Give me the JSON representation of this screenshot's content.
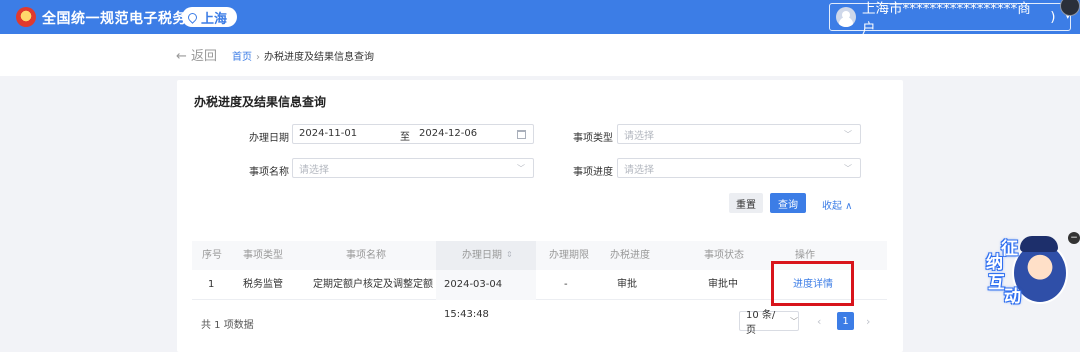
{
  "header": {
    "site_title": "全国统一规范电子税务局",
    "region": "上海",
    "user": "上海市*****************商户",
    "user_caret": ")",
    "menu_caret": "▾"
  },
  "breadcrumb": {
    "back": "← 返回",
    "home": "首页",
    "separator": "›",
    "current": "办税进度及结果信息查询"
  },
  "card": {
    "title": "办税进度及结果信息查询"
  },
  "filters": {
    "date_label": "办理日期",
    "date_start": "2024-11-01",
    "date_to": "至",
    "date_end": "2024-12-06",
    "type_label": "事项类型",
    "type_placeholder": "请选择",
    "name_label": "事项名称",
    "name_placeholder": "请选择",
    "progress_label": "事项进度",
    "progress_placeholder": "请选择"
  },
  "actions": {
    "reset": "重置",
    "query": "查询",
    "collapse": "收起 ∧"
  },
  "table": {
    "columns": [
      "序号",
      "事项类型",
      "事项名称",
      "办理日期",
      "办理期限",
      "办税进度",
      "事项状态",
      "操作"
    ],
    "rows": [
      [
        "1",
        "税务监管",
        "定期定额户核定及调整定额",
        "2024-03-04 15:43:48",
        "-",
        "审批",
        "审批中",
        "进度详情"
      ]
    ]
  },
  "pagination": {
    "total": "共 1 项数据",
    "page_size": "10 条/页",
    "current_page": "1",
    "prev": "‹",
    "next": "›"
  },
  "assistant": {
    "chars": [
      "征",
      "纳",
      "互",
      "动"
    ]
  },
  "colors": {
    "primary": "#3c7de6",
    "highlight_box": "#d8141b"
  },
  "icons": [
    "emblem-icon",
    "location-pin-icon",
    "avatar-icon",
    "calendar-icon",
    "chevron-down-icon",
    "sort-icon",
    "close-icon"
  ]
}
